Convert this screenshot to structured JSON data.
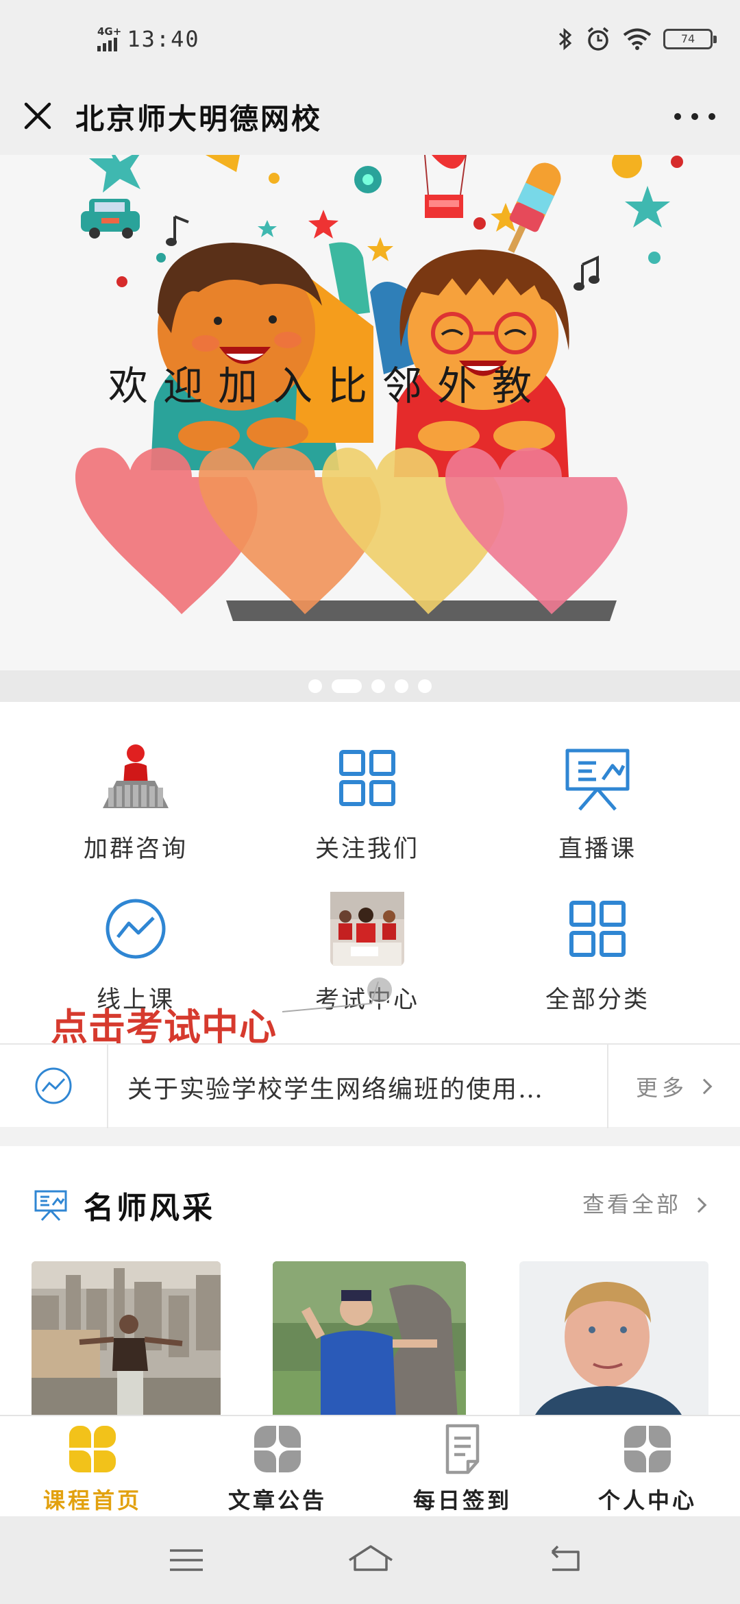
{
  "status_bar": {
    "network": "4G+",
    "time": "13:40",
    "battery": "74"
  },
  "title_bar": {
    "title": "北京师大明德网校"
  },
  "banner": {
    "caption": "欢迎加入比邻外教",
    "slide_count": 5,
    "active_slide": 2
  },
  "grid": {
    "items": [
      {
        "label": "加群咨询",
        "icon": "group-people-icon"
      },
      {
        "label": "关注我们",
        "icon": "grid-icon"
      },
      {
        "label": "直播课",
        "icon": "presentation-icon"
      },
      {
        "label": "线上课",
        "icon": "trend-circle-icon"
      },
      {
        "label": "考试中心",
        "icon": "exam-photo-icon"
      },
      {
        "label": "全部分类",
        "icon": "grid-icon"
      }
    ],
    "annotation": "点击考试中心"
  },
  "notice": {
    "text": "关于实验学校学生网络编班的使用…",
    "more": "更多"
  },
  "teachers": {
    "title": "名师风采",
    "view_all": "查看全部"
  },
  "bottom_nav": {
    "items": [
      {
        "label": "课程首页",
        "active": true
      },
      {
        "label": "文章公告",
        "active": false
      },
      {
        "label": "每日签到",
        "active": false
      },
      {
        "label": "个人中心",
        "active": false
      }
    ]
  },
  "colors": {
    "accent": "#e2a10f",
    "icon_blue": "#2f86d3",
    "annotation_red": "#d63a2e",
    "nav_gray": "#9a9a9a"
  }
}
